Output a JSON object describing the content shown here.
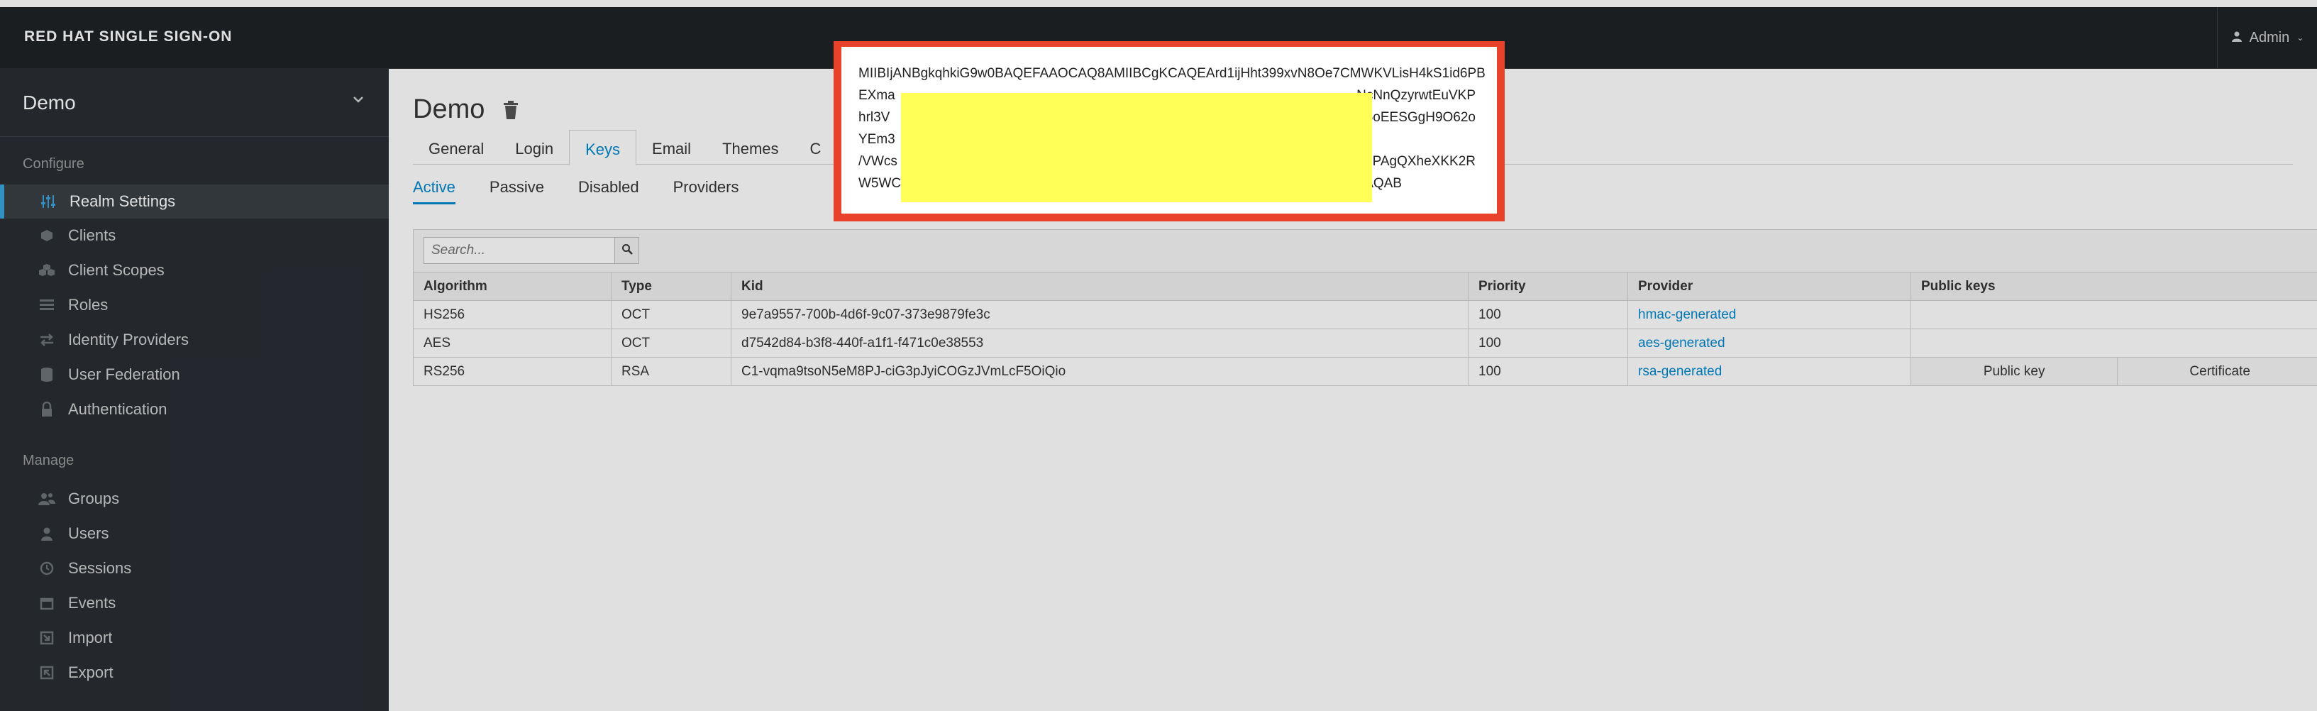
{
  "masthead": {
    "brand": "RED HAT SINGLE SIGN-ON",
    "user": "Admin"
  },
  "sidebar": {
    "realm": "Demo",
    "configure_label": "Configure",
    "manage_label": "Manage",
    "configure_items": [
      {
        "label": "Realm Settings",
        "icon": "sliders-icon",
        "active": true
      },
      {
        "label": "Clients",
        "icon": "cube-icon"
      },
      {
        "label": "Client Scopes",
        "icon": "cubes-icon"
      },
      {
        "label": "Roles",
        "icon": "list-icon"
      },
      {
        "label": "Identity Providers",
        "icon": "exchange-icon"
      },
      {
        "label": "User Federation",
        "icon": "database-icon"
      },
      {
        "label": "Authentication",
        "icon": "lock-icon"
      }
    ],
    "manage_items": [
      {
        "label": "Groups",
        "icon": "users-icon"
      },
      {
        "label": "Users",
        "icon": "user-icon"
      },
      {
        "label": "Sessions",
        "icon": "clock-icon"
      },
      {
        "label": "Events",
        "icon": "calendar-icon"
      },
      {
        "label": "Import",
        "icon": "import-icon"
      },
      {
        "label": "Export",
        "icon": "export-icon"
      }
    ]
  },
  "main": {
    "title": "Demo",
    "tabs": [
      "General",
      "Login",
      "Keys",
      "Email",
      "Themes",
      "C"
    ],
    "active_tab": "Keys",
    "subtabs": [
      "Active",
      "Passive",
      "Disabled",
      "Providers"
    ],
    "active_subtab": "Active",
    "search_placeholder": "Search...",
    "table": {
      "headers": [
        "Algorithm",
        "Type",
        "Kid",
        "Priority",
        "Provider",
        "Public keys"
      ],
      "rows": [
        {
          "algorithm": "HS256",
          "type": "OCT",
          "kid": "9e7a9557-700b-4d6f-9c07-373e9879fe3c",
          "priority": "100",
          "provider": "hmac-generated"
        },
        {
          "algorithm": "AES",
          "type": "OCT",
          "kid": "d7542d84-b3f8-440f-a1f1-f471c0e38553",
          "priority": "100",
          "provider": "aes-generated"
        },
        {
          "algorithm": "RS256",
          "type": "RSA",
          "kid": "C1-vqma9tsoN5eM8PJ-ciG3pJyiCOGzJVmLcF5OiQio",
          "priority": "100",
          "provider": "rsa-generated",
          "public_key_btn": "Public key",
          "certificate_btn": "Certificate"
        }
      ]
    }
  },
  "modal": {
    "lines": [
      "MIIBIjANBgkqhkiG9w0BAQEFAAOCAQ8AMIIBCgKCAQEArd1ijHht399xvN8Oe7CMWKVLisH4kS1id6PB",
      "EXma",
      "hrl3V",
      "YEm3",
      "/VWcs",
      "W5WC"
    ],
    "right_fragments": [
      "NcNnQzyrwtEuVKP",
      "o6oEESGgH9O62o",
      "",
      "JIPAgQXheXKK2R",
      "AQAB"
    ],
    "highlight_color": "#ffff58",
    "frame_color": "#e8432a"
  }
}
